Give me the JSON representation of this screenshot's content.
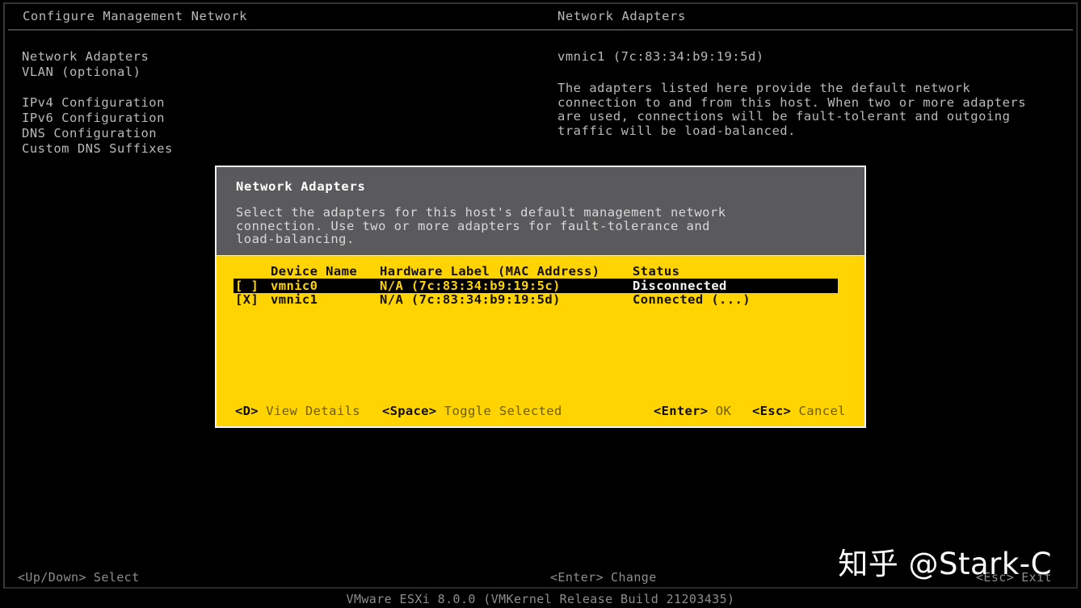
{
  "theme": {
    "screen_bg": "#000000",
    "text_dim": "#b9b9b9",
    "dialog_header_bg": "#5a5a5d",
    "dialog_body_bg": "#ffd400",
    "dialog_border": "#f2f2f2",
    "selected_row_bg": "#000000",
    "selected_row_fg": "#ffd400",
    "status_text": "#8d8d8d"
  },
  "titlebar": {
    "left_title": "Configure Management Network",
    "right_title": "Network Adapters"
  },
  "menu": {
    "items": [
      {
        "label": "Network Adapters",
        "selected": true
      },
      {
        "label": "VLAN (optional)",
        "selected": false
      },
      {
        "label": "",
        "spacer": true
      },
      {
        "label": "IPv4 Configuration",
        "selected": false
      },
      {
        "label": "IPv6 Configuration",
        "selected": false
      },
      {
        "label": "DNS Configuration",
        "selected": false
      },
      {
        "label": "Custom DNS Suffixes",
        "selected": false
      }
    ]
  },
  "detail": {
    "adapter_summary": "vmnic1 (7c:83:34:b9:19:5d)",
    "description_lines": [
      "The adapters listed here provide the default network",
      "connection to and from this host. When two or more adapters",
      "are used, connections will be fault-tolerant and outgoing",
      "traffic will be load-balanced."
    ]
  },
  "dialog": {
    "title": "Network Adapters",
    "description_lines": [
      "Select the adapters for this host's default management network",
      "connection. Use two or more adapters for fault-tolerance and",
      "load-balancing."
    ],
    "table": {
      "headers": {
        "check": "",
        "device_name": "Device Name",
        "hardware_label": "Hardware Label (MAC Address)",
        "status": "Status"
      },
      "rows": [
        {
          "check": "[ ]",
          "checked": false,
          "device_name": "vmnic0",
          "hardware_label": "N/A (7c:83:34:b9:19:5c)",
          "status": "Disconnected",
          "selected": true
        },
        {
          "check": "[X]",
          "checked": true,
          "device_name": "vmnic1",
          "hardware_label": "N/A (7c:83:34:b9:19:5d)",
          "status": "Connected (...)",
          "selected": false
        }
      ]
    },
    "footer": {
      "view_details_key": "<D>",
      "view_details_label": "View Details",
      "toggle_key": "<Space>",
      "toggle_label": "Toggle Selected",
      "ok_key": "<Enter>",
      "ok_label": "OK",
      "cancel_key": "<Esc>",
      "cancel_label": "Cancel"
    }
  },
  "statusbar": {
    "updown_key": "<Up/Down>",
    "updown_label": "Select",
    "change_key": "<Enter>",
    "change_label": "Change",
    "exit_key": "<Esc>",
    "exit_label": "Exit"
  },
  "version_line": "VMware ESXi 8.0.0 (VMKernel Release Build 21203435)",
  "watermark": "知乎 @Stark-C"
}
